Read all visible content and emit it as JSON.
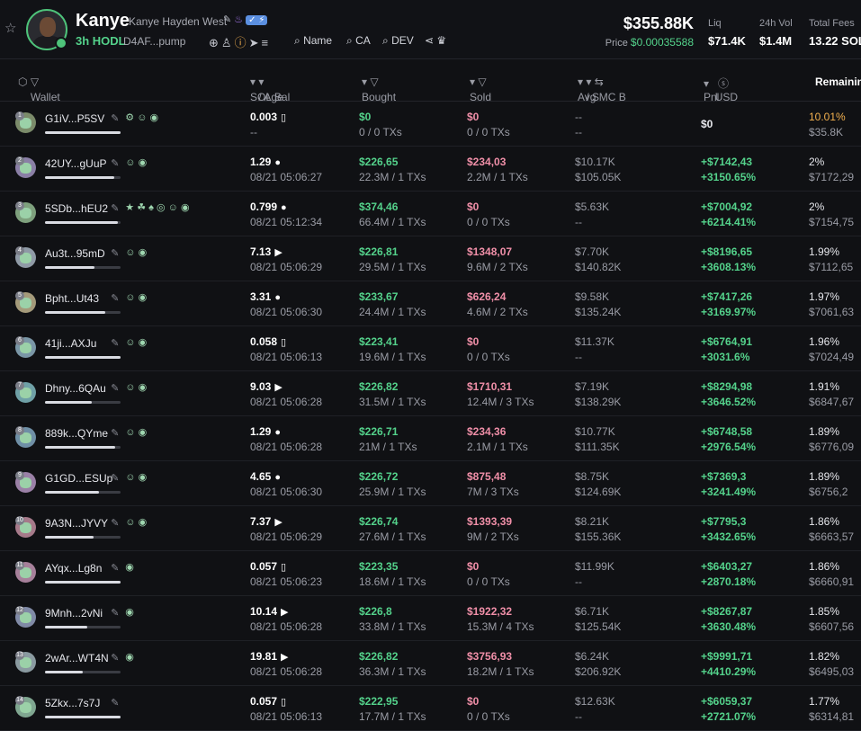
{
  "header": {
    "token_name": "Kanye",
    "full_name": "Kanye Hayden West",
    "age": "3h",
    "hodl_label": "HODL",
    "address": "D4AF...pump",
    "search_name": "Name",
    "search_ca": "CA",
    "search_dev": "DEV",
    "market_cap": "$355.88K",
    "price_label": "Price",
    "price_value": "$0.00035588",
    "stats": [
      {
        "label": "Liq",
        "value": "$71.4K"
      },
      {
        "label": "24h Vol",
        "value": "$1.4M"
      },
      {
        "label": "Total Fees",
        "value": "13.22 SOL"
      }
    ]
  },
  "columns": {
    "wallet": "Wallet",
    "sol_bal": "SOL Bal",
    "age": "/ Age",
    "bought": "Bought",
    "sold": "Sold",
    "avg_mc": "Avg MC B",
    "avg_mc_s": "/ S",
    "pnl": "Pnl",
    "usd": "USD",
    "remaining": "Remaining"
  },
  "rows": [
    {
      "rank": "1",
      "wallet": "G1iV...P5SV",
      "badges": "⚙ ☺ ◉",
      "progress": 1.0,
      "sol": "0.003",
      "sol_icon": "▯",
      "age": "--",
      "bought": "$0",
      "bought_sub": "0 / 0 TXs",
      "sold": "$0",
      "sold_sub": "0 / 0 TXs",
      "mc_b": "--",
      "mc_s": "--",
      "pnl": "$0",
      "pnl_pct": "",
      "rem_pct": "10.01%",
      "rem_usd": "$35.8K",
      "color": "#7b8b6a"
    },
    {
      "rank": "2",
      "wallet": "42UY...gUuP",
      "badges": "☺ ◉",
      "progress": 0.92,
      "sol": "1.29",
      "sol_icon": "●",
      "age": "08/21 05:06:27",
      "bought": "$226,65",
      "bought_sub": "22.3M / 1 TXs",
      "sold": "$234,03",
      "sold_sub": "2.2M / 1 TXs",
      "mc_b": "$10.17K",
      "mc_s": "$105.05K",
      "pnl": "+$7142,43",
      "pnl_pct": "+3150.65%",
      "rem_pct": "2%",
      "rem_usd": "$7172,29",
      "color": "#8a7fa6"
    },
    {
      "rank": "3",
      "wallet": "5SDb...hEU2",
      "badges": "★ ☘ ♠ ◎ ☺ ◉",
      "progress": 0.96,
      "sol": "0.799",
      "sol_icon": "●",
      "age": "08/21 05:12:34",
      "bought": "$374,46",
      "bought_sub": "66.4M / 1 TXs",
      "sold": "$0",
      "sold_sub": "0 / 0 TXs",
      "mc_b": "$5.63K",
      "mc_s": "--",
      "pnl": "+$7004,92",
      "pnl_pct": "+6214.41%",
      "rem_pct": "2%",
      "rem_usd": "$7154,75",
      "color": "#7ea07d"
    },
    {
      "rank": "4",
      "wallet": "Au3t...95mD",
      "badges": "☺ ◉",
      "progress": 0.66,
      "sol": "7.13",
      "sol_icon": "▶",
      "age": "08/21 05:06:29",
      "bought": "$226,81",
      "bought_sub": "29.5M / 1 TXs",
      "sold": "$1348,07",
      "sold_sub": "9.6M / 2 TXs",
      "mc_b": "$7.70K",
      "mc_s": "$140.82K",
      "pnl": "+$8196,65",
      "pnl_pct": "+3608.13%",
      "rem_pct": "1.99%",
      "rem_usd": "$7112,65",
      "color": "#8f9aa6"
    },
    {
      "rank": "5",
      "wallet": "Bpht...Ut43",
      "badges": "☺ ◉",
      "progress": 0.8,
      "sol": "3.31",
      "sol_icon": "●",
      "age": "08/21 05:06:30",
      "bought": "$233,67",
      "bought_sub": "24.4M / 1 TXs",
      "sold": "$626,24",
      "sold_sub": "4.6M / 2 TXs",
      "mc_b": "$9.58K",
      "mc_s": "$135.24K",
      "pnl": "+$7417,26",
      "pnl_pct": "+3169.97%",
      "rem_pct": "1.97%",
      "rem_usd": "$7061,63",
      "color": "#a49a7a"
    },
    {
      "rank": "6",
      "wallet": "41ji...AXJu",
      "badges": "☺ ◉",
      "progress": 1.0,
      "sol": "0.058",
      "sol_icon": "▯",
      "age": "08/21 05:06:13",
      "bought": "$223,41",
      "bought_sub": "19.6M / 1 TXs",
      "sold": "$0",
      "sold_sub": "0 / 0 TXs",
      "mc_b": "$11.37K",
      "mc_s": "--",
      "pnl": "+$6764,91",
      "pnl_pct": "+3031.6%",
      "rem_pct": "1.96%",
      "rem_usd": "$7024,49",
      "color": "#7a96a6"
    },
    {
      "rank": "7",
      "wallet": "Dhny...6QAu",
      "badges": "☺ ◉",
      "progress": 0.62,
      "sol": "9.03",
      "sol_icon": "▶",
      "age": "08/21 05:06:28",
      "bought": "$226,82",
      "bought_sub": "31.5M / 1 TXs",
      "sold": "$1710,31",
      "sold_sub": "12.4M / 3 TXs",
      "mc_b": "$7.19K",
      "mc_s": "$138.29K",
      "pnl": "+$8294,98",
      "pnl_pct": "+3646.52%",
      "rem_pct": "1.91%",
      "rem_usd": "$6847,67",
      "color": "#6fa0a6"
    },
    {
      "rank": "8",
      "wallet": "889k...QYme",
      "badges": "☺ ◉",
      "progress": 0.93,
      "sol": "1.29",
      "sol_icon": "●",
      "age": "08/21 05:06:28",
      "bought": "$226,71",
      "bought_sub": "21M / 1 TXs",
      "sold": "$234,36",
      "sold_sub": "2.1M / 1 TXs",
      "mc_b": "$10.77K",
      "mc_s": "$111.35K",
      "pnl": "+$6748,58",
      "pnl_pct": "+2976.54%",
      "rem_pct": "1.89%",
      "rem_usd": "$6776,09",
      "color": "#6f8fa6"
    },
    {
      "rank": "9",
      "wallet": "G1GD...ESUp",
      "badges": "☺ ◉",
      "progress": 0.72,
      "sol": "4.65",
      "sol_icon": "●",
      "age": "08/21 05:06:30",
      "bought": "$226,72",
      "bought_sub": "25.9M / 1 TXs",
      "sold": "$875,48",
      "sold_sub": "7M / 3 TXs",
      "mc_b": "$8.75K",
      "mc_s": "$124.69K",
      "pnl": "+$7369,3",
      "pnl_pct": "+3241.49%",
      "rem_pct": "1.89%",
      "rem_usd": "$6756,2",
      "color": "#9a80a6"
    },
    {
      "rank": "10",
      "wallet": "9A3N...JYVY",
      "badges": "☺ ◉",
      "progress": 0.64,
      "sol": "7.37",
      "sol_icon": "▶",
      "age": "08/21 05:06:29",
      "bought": "$226,74",
      "bought_sub": "27.6M / 1 TXs",
      "sold": "$1393,39",
      "sold_sub": "9M / 2 TXs",
      "mc_b": "$8.21K",
      "mc_s": "$155.36K",
      "pnl": "+$7795,3",
      "pnl_pct": "+3432.65%",
      "rem_pct": "1.86%",
      "rem_usd": "$6663,57",
      "color": "#a67a8a"
    },
    {
      "rank": "11",
      "wallet": "AYqx...Lg8n",
      "badges": "◉",
      "progress": 1.0,
      "sol": "0.057",
      "sol_icon": "▯",
      "age": "08/21 05:06:23",
      "bought": "$223,35",
      "bought_sub": "18.6M / 1 TXs",
      "sold": "$0",
      "sold_sub": "0 / 0 TXs",
      "mc_b": "$11.99K",
      "mc_s": "--",
      "pnl": "+$6403,27",
      "pnl_pct": "+2870.18%",
      "rem_pct": "1.86%",
      "rem_usd": "$6660,91",
      "color": "#a6809a"
    },
    {
      "rank": "12",
      "wallet": "9Mnh...2vNi",
      "badges": "◉",
      "progress": 0.56,
      "sol": "10.14",
      "sol_icon": "▶",
      "age": "08/21 05:06:28",
      "bought": "$226,8",
      "bought_sub": "33.8M / 1 TXs",
      "sold": "$1922,32",
      "sold_sub": "15.3M / 4 TXs",
      "mc_b": "$6.71K",
      "mc_s": "$125.54K",
      "pnl": "+$8267,87",
      "pnl_pct": "+3630.48%",
      "rem_pct": "1.85%",
      "rem_usd": "$6607,56",
      "color": "#808aa6"
    },
    {
      "rank": "13",
      "wallet": "2wAr...WT4N",
      "badges": "◉",
      "progress": 0.5,
      "sol": "19.81",
      "sol_icon": "▶",
      "age": "08/21 05:06:28",
      "bought": "$226,82",
      "bought_sub": "36.3M / 1 TXs",
      "sold": "$3756,93",
      "sold_sub": "18.2M / 1 TXs",
      "mc_b": "$6.24K",
      "mc_s": "$206.92K",
      "pnl": "+$9991,71",
      "pnl_pct": "+4410.29%",
      "rem_pct": "1.82%",
      "rem_usd": "$6495,03",
      "color": "#8a9aa0"
    },
    {
      "rank": "14",
      "wallet": "5Zkx...7s7J",
      "badges": "",
      "progress": 1.0,
      "sol": "0.057",
      "sol_icon": "▯",
      "age": "08/21 05:06:13",
      "bought": "$222,95",
      "bought_sub": "17.7M / 1 TXs",
      "sold": "$0",
      "sold_sub": "0 / 0 TXs",
      "mc_b": "$12.63K",
      "mc_s": "--",
      "pnl": "+$6059,37",
      "pnl_pct": "+2721.07%",
      "rem_pct": "1.77%",
      "rem_usd": "$6314,81",
      "color": "#7fa690"
    }
  ]
}
